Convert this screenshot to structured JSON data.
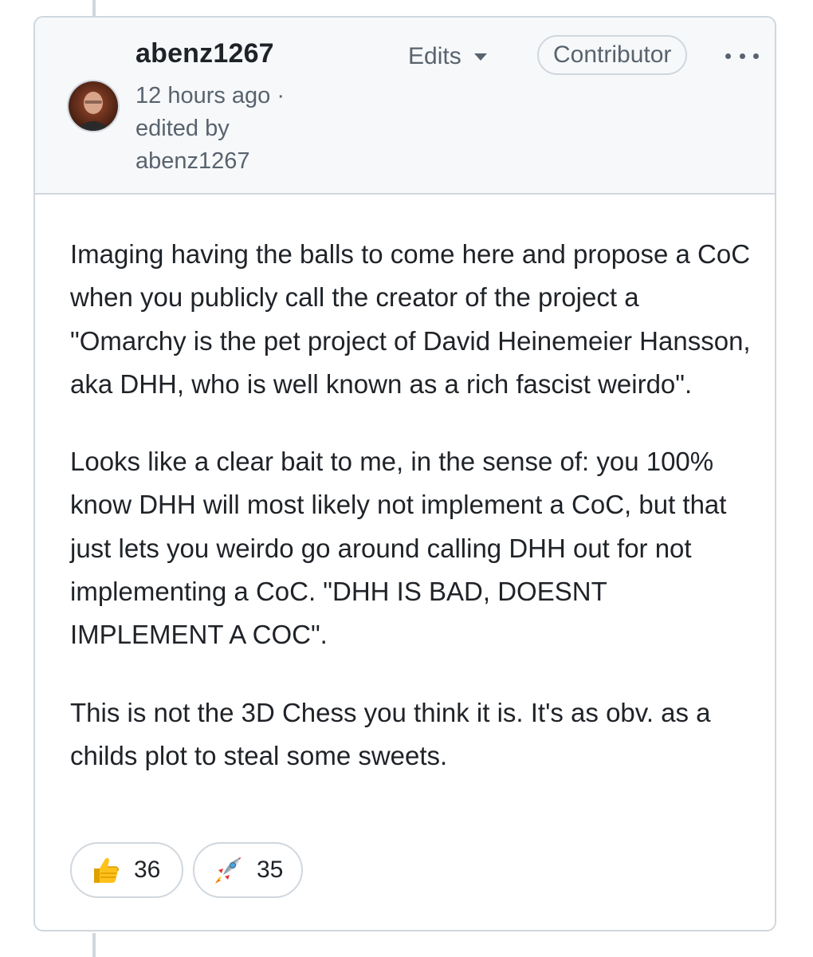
{
  "comment": {
    "author": "abenz1267",
    "timestamp": "12 hours ago ·",
    "edited_label": "edited by",
    "edited_by": "abenz1267",
    "edits_label": "Edits",
    "role_badge": "Contributor",
    "body": [
      "Imaging having the balls to come here and propose a CoC when you publicly call the creator of the project a \"Omarchy is the pet project of David Heinemeier Hansson, aka DHH, who is well known as a rich fascist weirdo\".",
      "Looks like a clear bait to me, in the sense of: you 100% know DHH will most likely not implement a CoC, but that just lets you weirdo go around calling DHH out for not implementing a CoC. \"DHH IS BAD, DOESNT IMPLEMENT A COC\".",
      "This is not the 3D Chess you think it is. It's as obv. as a childs plot to steal some sweets."
    ],
    "reactions": [
      {
        "icon": "thumbs-up-icon",
        "count": "36"
      },
      {
        "icon": "rocket-icon",
        "count": "35"
      }
    ]
  },
  "colors": {
    "border": "#d0d7de",
    "header_bg": "#f6f8fa",
    "muted_text": "#59636e",
    "body_text": "#1f2328"
  }
}
